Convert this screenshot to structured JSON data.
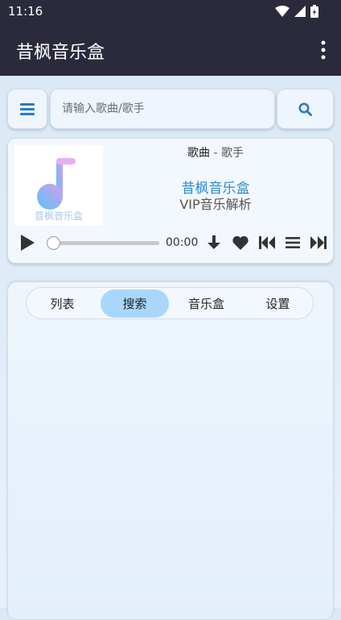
{
  "status_bar": {
    "time": "11:16"
  },
  "app_bar": {
    "title": "昔枫音乐盒"
  },
  "search": {
    "placeholder": "请输入歌曲/歌手"
  },
  "player": {
    "song": "歌曲",
    "separator": " - ",
    "artist": "歌手",
    "app_name": "昔枫音乐盒",
    "app_desc": "VIP音乐解析",
    "cover_text": "昔枫音乐盒",
    "time": "00:00",
    "progress": 0
  },
  "tabs": [
    {
      "label": "列表"
    },
    {
      "label": "搜索",
      "active": true
    },
    {
      "label": "音乐盒"
    },
    {
      "label": "设置"
    }
  ],
  "colors": {
    "accent": "#2a8ad6",
    "tab_active": "#a9d7fb",
    "appbar": "#2a2a3c"
  }
}
